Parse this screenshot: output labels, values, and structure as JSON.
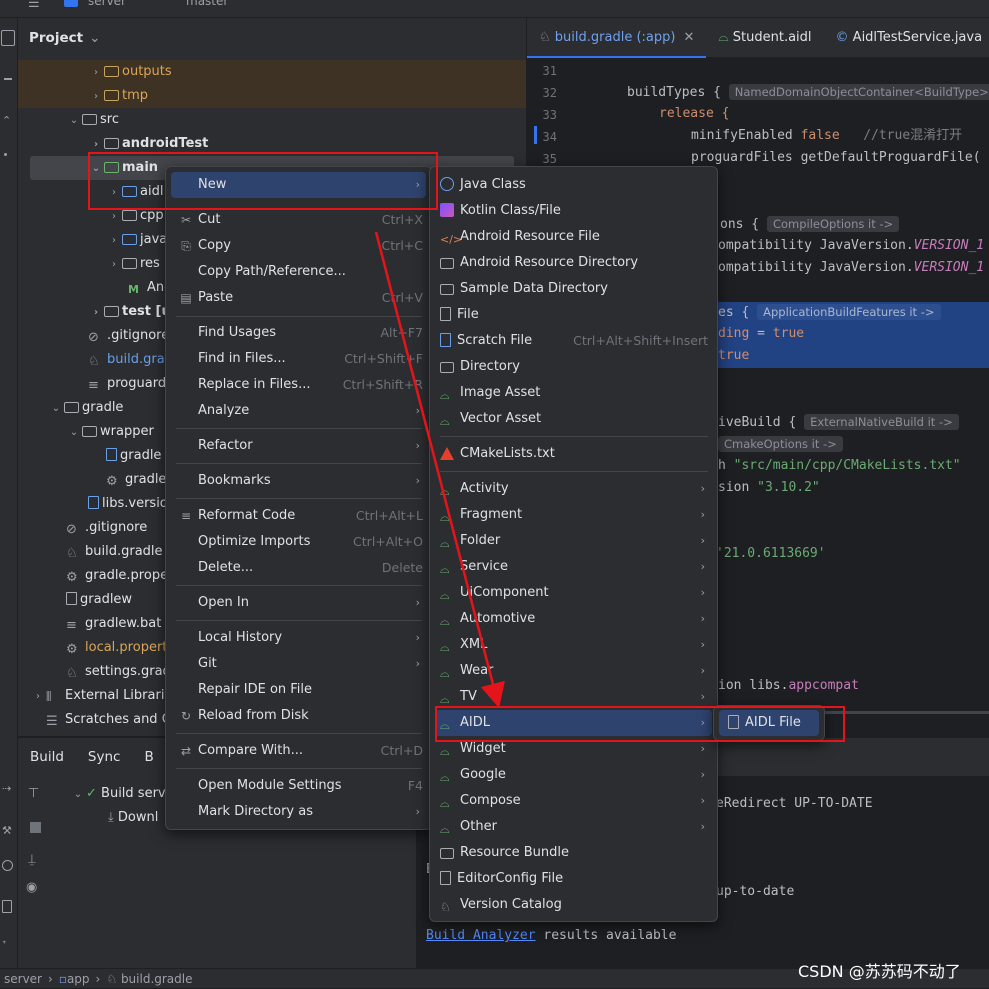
{
  "titlebar": {
    "project": "server",
    "branch": "master"
  },
  "project_panel": {
    "title": "Project"
  },
  "tree": [
    {
      "label": "outputs",
      "color": "orange",
      "kind": "folder"
    },
    {
      "label": "tmp",
      "color": "orange",
      "kind": "folder"
    },
    {
      "label": "src",
      "kind": "folder"
    },
    {
      "label": "androidTest",
      "kind": "folder"
    },
    {
      "label": "main",
      "kind": "folder"
    },
    {
      "label": "aidl",
      "kind": "folder"
    },
    {
      "label": "cpp",
      "kind": "folder"
    },
    {
      "label": "java",
      "kind": "folder"
    },
    {
      "label": "res",
      "kind": "folder"
    },
    {
      "label": "And",
      "kind": "file"
    },
    {
      "label": "test [u",
      "kind": "folder"
    },
    {
      "label": ".gitignore",
      "kind": "file"
    },
    {
      "label": "build.grad",
      "kind": "file",
      "color": "blue"
    },
    {
      "label": "proguard",
      "kind": "file"
    },
    {
      "label": "gradle",
      "kind": "folder"
    },
    {
      "label": "wrapper",
      "kind": "folder"
    },
    {
      "label": "gradle",
      "kind": "file"
    },
    {
      "label": "gradle",
      "kind": "file"
    },
    {
      "label": "libs.versio",
      "kind": "file"
    },
    {
      "label": ".gitignore",
      "kind": "file"
    },
    {
      "label": "build.gradle",
      "kind": "file"
    },
    {
      "label": "gradle.prope",
      "kind": "file"
    },
    {
      "label": "gradlew",
      "kind": "file"
    },
    {
      "label": "gradlew.bat",
      "kind": "file"
    },
    {
      "label": "local.propert",
      "kind": "file",
      "color": "orange"
    },
    {
      "label": "settings.grad",
      "kind": "file"
    },
    {
      "label": "External Librarie",
      "kind": "folder"
    },
    {
      "label": "Scratches and C",
      "kind": "folder"
    }
  ],
  "editor_tabs": [
    {
      "label": "build.gradle (:app)",
      "active": true
    },
    {
      "label": "Student.aidl"
    },
    {
      "label": "AidlTestService.java"
    }
  ],
  "line_numbers": [
    "31",
    "32",
    "33",
    "34",
    "35"
  ],
  "code": {
    "l32": "buildTypes {",
    "l32_hint": "NamedDomainObjectContainer<BuildType> it",
    "l33": "release {",
    "l34a": "minifyEnabled ",
    "l34b": "false",
    "l34c": "//true混淆打开",
    "l35": "proguardFiles getDefaultProguardFile(",
    "l_opts": "ons {",
    "l_opts_hint": "CompileOptions it ->",
    "l_compat1a": "ompatibility JavaVersion.",
    "l_compat1b": "VERSION_1",
    "l_compat2a": "ompatibility JavaVersion.",
    "l_compat2b": "VERSION_1",
    "l_feat": "es {",
    "l_feat_hint": "ApplicationBuildFeatures it ->",
    "l_bind_a": "ding",
    "l_bind_b": " = ",
    "l_bind_c": "true",
    "l_true": "true",
    "l_native": "iveBuild {",
    "l_native_hint": "ExternalNativeBuild it ->",
    "l_cmake_hint": "CmakeOptions it ->",
    "l_path_a": "h ",
    "l_path_b": "\"src/main/cpp/CMakeLists.txt\"",
    "l_ver_a": "sion ",
    "l_ver_b": "\"3.10.2\"",
    "l_ndk": "'21.0.6113669'",
    "l_impl_a": "ion libs.",
    "l_impl_b": "appcompat"
  },
  "build_panel": {
    "tabs": [
      "Build",
      "Sync",
      "B"
    ],
    "tree": [
      "Build serv",
      "Downl"
    ]
  },
  "console": {
    "line1": "eRedirect UP-TO-DATE",
    "line2": "up-to-date",
    "link": "Build Analyzer",
    "link_rest": " results available"
  },
  "context_menu": {
    "items": [
      {
        "label": "New",
        "submenu": true
      },
      {
        "label": "Cut",
        "shortcut": "Ctrl+X",
        "icon": "✂"
      },
      {
        "label": "Copy",
        "shortcut": "Ctrl+C",
        "icon": "⎘"
      },
      {
        "label": "Copy Path/Reference..."
      },
      {
        "label": "Paste",
        "shortcut": "Ctrl+V",
        "icon": "📋"
      },
      {
        "label": "Find Usages",
        "shortcut": "Alt+F7"
      },
      {
        "label": "Find in Files...",
        "shortcut": "Ctrl+Shift+F"
      },
      {
        "label": "Replace in Files...",
        "shortcut": "Ctrl+Shift+R"
      },
      {
        "label": "Analyze",
        "submenu": true
      },
      {
        "label": "Refactor",
        "submenu": true
      },
      {
        "label": "Bookmarks",
        "submenu": true
      },
      {
        "label": "Reformat Code",
        "shortcut": "Ctrl+Alt+L",
        "icon": "≡"
      },
      {
        "label": "Optimize Imports",
        "shortcut": "Ctrl+Alt+O"
      },
      {
        "label": "Delete...",
        "shortcut": "Delete"
      },
      {
        "label": "Open In",
        "submenu": true
      },
      {
        "label": "Local History",
        "submenu": true
      },
      {
        "label": "Git",
        "submenu": true
      },
      {
        "label": "Repair IDE on File"
      },
      {
        "label": "Reload from Disk",
        "icon": "↻"
      },
      {
        "label": "Compare With...",
        "shortcut": "Ctrl+D",
        "icon": "⇄"
      },
      {
        "label": "Open Module Settings",
        "shortcut": "F4"
      },
      {
        "label": "Mark Directory as",
        "submenu": true
      }
    ]
  },
  "new_submenu": {
    "items": [
      {
        "label": "Java Class"
      },
      {
        "label": "Kotlin Class/File"
      },
      {
        "label": "Android Resource File"
      },
      {
        "label": "Android Resource Directory"
      },
      {
        "label": "Sample Data Directory"
      },
      {
        "label": "File"
      },
      {
        "label": "Scratch File",
        "shortcut": "Ctrl+Alt+Shift+Insert"
      },
      {
        "label": "Directory"
      },
      {
        "label": "Image Asset"
      },
      {
        "label": "Vector Asset"
      },
      {
        "label": "CMakeLists.txt"
      },
      {
        "label": "Activity",
        "submenu": true
      },
      {
        "label": "Fragment",
        "submenu": true
      },
      {
        "label": "Folder",
        "submenu": true
      },
      {
        "label": "Service",
        "submenu": true
      },
      {
        "label": "UiComponent",
        "submenu": true
      },
      {
        "label": "Automotive",
        "submenu": true
      },
      {
        "label": "XML",
        "submenu": true
      },
      {
        "label": "Wear",
        "submenu": true
      },
      {
        "label": "TV",
        "submenu": true
      },
      {
        "label": "AIDL",
        "submenu": true
      },
      {
        "label": "Widget",
        "submenu": true
      },
      {
        "label": "Google",
        "submenu": true
      },
      {
        "label": "Compose",
        "submenu": true
      },
      {
        "label": "Other",
        "submenu": true
      },
      {
        "label": "Resource Bundle"
      },
      {
        "label": "EditorConfig File"
      },
      {
        "label": "Version Catalog"
      }
    ]
  },
  "aidl_submenu": {
    "item": "AIDL File"
  },
  "statusbar": {
    "path": [
      "server",
      "app",
      "build.gradle"
    ]
  },
  "watermark": "CSDN @苏苏码不动了",
  "colors": {
    "accent": "#3574f0",
    "highlight": "#2e436e",
    "annotation": "#e5141b",
    "android_green": "#6ab56e"
  }
}
